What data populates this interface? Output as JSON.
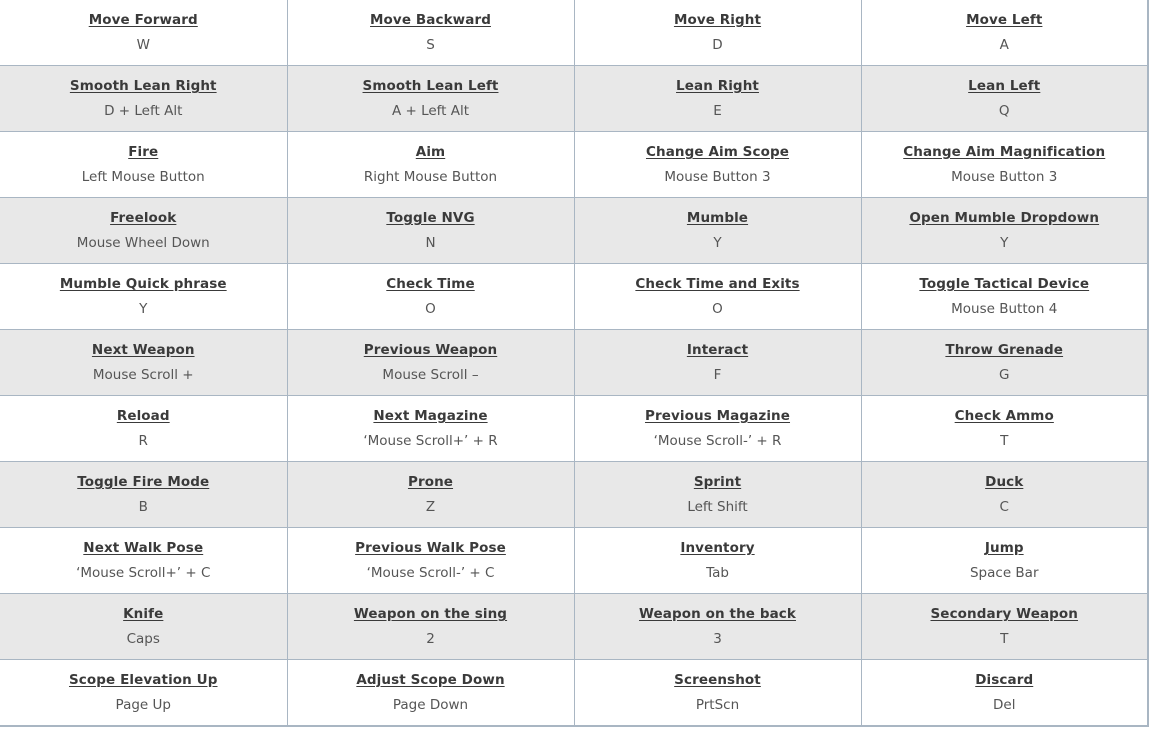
{
  "rows": [
    [
      {
        "action": "Move Forward",
        "key": "W"
      },
      {
        "action": "Move Backward",
        "key": "S"
      },
      {
        "action": "Move Right",
        "key": "D"
      },
      {
        "action": "Move Left",
        "key": "A"
      }
    ],
    [
      {
        "action": "Smooth Lean Right",
        "key": "D + Left Alt"
      },
      {
        "action": "Smooth Lean Left",
        "key": "A + Left Alt"
      },
      {
        "action": "Lean Right",
        "key": "E"
      },
      {
        "action": "Lean Left",
        "key": "Q"
      }
    ],
    [
      {
        "action": "Fire",
        "key": "Left Mouse Button"
      },
      {
        "action": "Aim",
        "key": "Right Mouse Button"
      },
      {
        "action": "Change Aim Scope",
        "key": "Mouse Button 3"
      },
      {
        "action": "Change Aim Magnification",
        "key": "Mouse Button 3"
      }
    ],
    [
      {
        "action": "Freelook",
        "key": "Mouse Wheel Down"
      },
      {
        "action": "Toggle NVG",
        "key": "N"
      },
      {
        "action": "Mumble",
        "key": "Y"
      },
      {
        "action": "Open Mumble Dropdown",
        "key": "Y"
      }
    ],
    [
      {
        "action": "Mumble Quick phrase",
        "key": "Y"
      },
      {
        "action": "Check Time",
        "key": "O"
      },
      {
        "action": "Check Time and Exits",
        "key": "O"
      },
      {
        "action": "Toggle Tactical Device",
        "key": "Mouse Button 4"
      }
    ],
    [
      {
        "action": "Next Weapon",
        "key": "Mouse Scroll +"
      },
      {
        "action": "Previous Weapon",
        "key": "Mouse Scroll –"
      },
      {
        "action": "Interact",
        "key": "F"
      },
      {
        "action": "Throw Grenade",
        "key": "G"
      }
    ],
    [
      {
        "action": "Reload",
        "key": "R"
      },
      {
        "action": "Next Magazine",
        "key": "‘Mouse Scroll+’ + R"
      },
      {
        "action": "Previous Magazine",
        "key": "‘Mouse Scroll-’ + R"
      },
      {
        "action": "Check Ammo",
        "key": "T"
      }
    ],
    [
      {
        "action": "Toggle Fire Mode",
        "key": "B"
      },
      {
        "action": "Prone",
        "key": "Z"
      },
      {
        "action": "Sprint",
        "key": "Left Shift"
      },
      {
        "action": "Duck",
        "key": "C"
      }
    ],
    [
      {
        "action": "Next Walk Pose",
        "key": "‘Mouse Scroll+’ + C"
      },
      {
        "action": "Previous Walk Pose",
        "key": "‘Mouse Scroll-’ + C"
      },
      {
        "action": "Inventory",
        "key": "Tab"
      },
      {
        "action": "Jump",
        "key": "Space Bar"
      }
    ],
    [
      {
        "action": "Knife",
        "key": "Caps"
      },
      {
        "action": "Weapon on the sing",
        "key": "2"
      },
      {
        "action": "Weapon on the back",
        "key": "3"
      },
      {
        "action": "Secondary Weapon",
        "key": "T"
      }
    ],
    [
      {
        "action": "Scope Elevation Up",
        "key": "Page Up"
      },
      {
        "action": "Adjust Scope Down",
        "key": "Page Down"
      },
      {
        "action": "Screenshot",
        "key": "PrtScn"
      },
      {
        "action": "Discard",
        "key": "Del"
      }
    ]
  ],
  "colors": {
    "border": "#a9b6c3",
    "stripe": "#e8e8e8",
    "action_text": "#3a3a3a",
    "key_text": "#555555"
  }
}
